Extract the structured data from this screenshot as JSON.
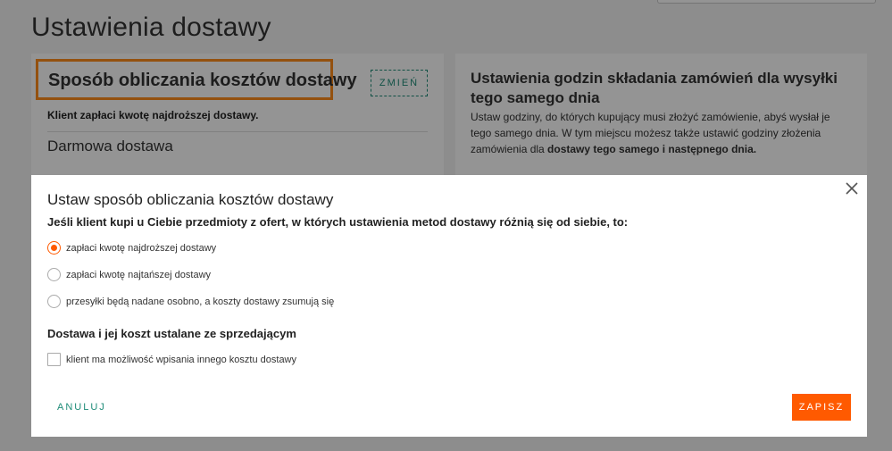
{
  "page": {
    "title": "Ustawienia dostawy"
  },
  "cost_card": {
    "title": "Sposób obliczania kosztów dostawy",
    "change_label": "ZMIEŃ",
    "summary": "Klient zapłaci kwotę najdroższej dostawy.",
    "free_shipping_title": "Darmowa dostawa"
  },
  "same_day_card": {
    "title": "Ustawienia godzin składania zamówień dla wysyłki tego samego dnia",
    "desc_part1": "Ustaw godziny, do których kupujący musi złożyć zamówienie, abyś wysłał je tego samego dnia. W tym miejscu możesz także ustawić godziny złożenia zamówienia dla ",
    "desc_bold": "dostawy tego samego i następnego dnia."
  },
  "modal": {
    "title": "Ustaw sposób obliczania kosztów dostawy",
    "question": "Jeśli klient kupi u Ciebie przedmioty z ofert, w których ustawienia metod dostawy różnią się od siebie, to:",
    "options": [
      {
        "label": "zapłaci kwotę najdroższej dostawy",
        "checked": true
      },
      {
        "label": "zapłaci kwotę najtańszej dostawy",
        "checked": false
      },
      {
        "label": "przesyłki będą nadane osobno, a koszty dostawy zsumują się",
        "checked": false
      }
    ],
    "seller_section_title": "Dostawa i jej koszt ustalane ze sprzedającym",
    "checkbox_label": "klient ma możliwość wpisania innego kosztu dostawy",
    "checkbox_checked": false,
    "cancel_label": "ANULUJ",
    "save_label": "ZAPISZ"
  },
  "colors": {
    "accent_orange": "#ff5a00",
    "highlight_orange": "#ff8c1a",
    "teal": "#1e8c78"
  }
}
